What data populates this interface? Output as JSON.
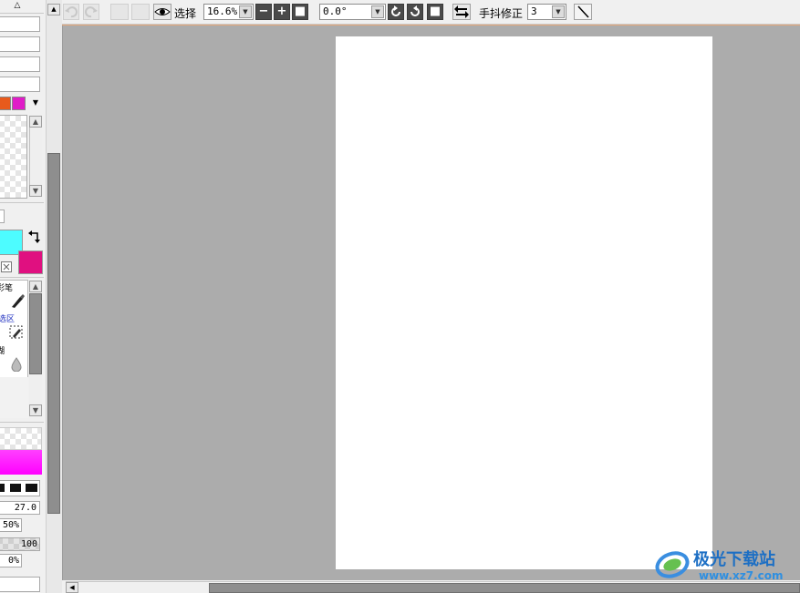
{
  "toolbar": {
    "selection_label": "选择",
    "zoom_value": "16.6%",
    "rotation_value": "0.0°",
    "stabilizer_label": "手抖修正",
    "stabilizer_value": "3"
  },
  "left_panel": {
    "tools": [
      {
        "label": "彩笔"
      },
      {
        "label": "选区"
      },
      {
        "label": "糊"
      }
    ],
    "brush_size": "27.0",
    "density": "50%",
    "max_size_value": "100",
    "min_density": "0%"
  },
  "colors": {
    "primary": "#4dfcff",
    "secondary": "#e01080",
    "palette": [
      "#e85a1c",
      "#e01cc8"
    ],
    "gradient_preview": "#ff00ff"
  },
  "watermark": {
    "brand": "极光下载站",
    "url": "www.xz7.com"
  }
}
